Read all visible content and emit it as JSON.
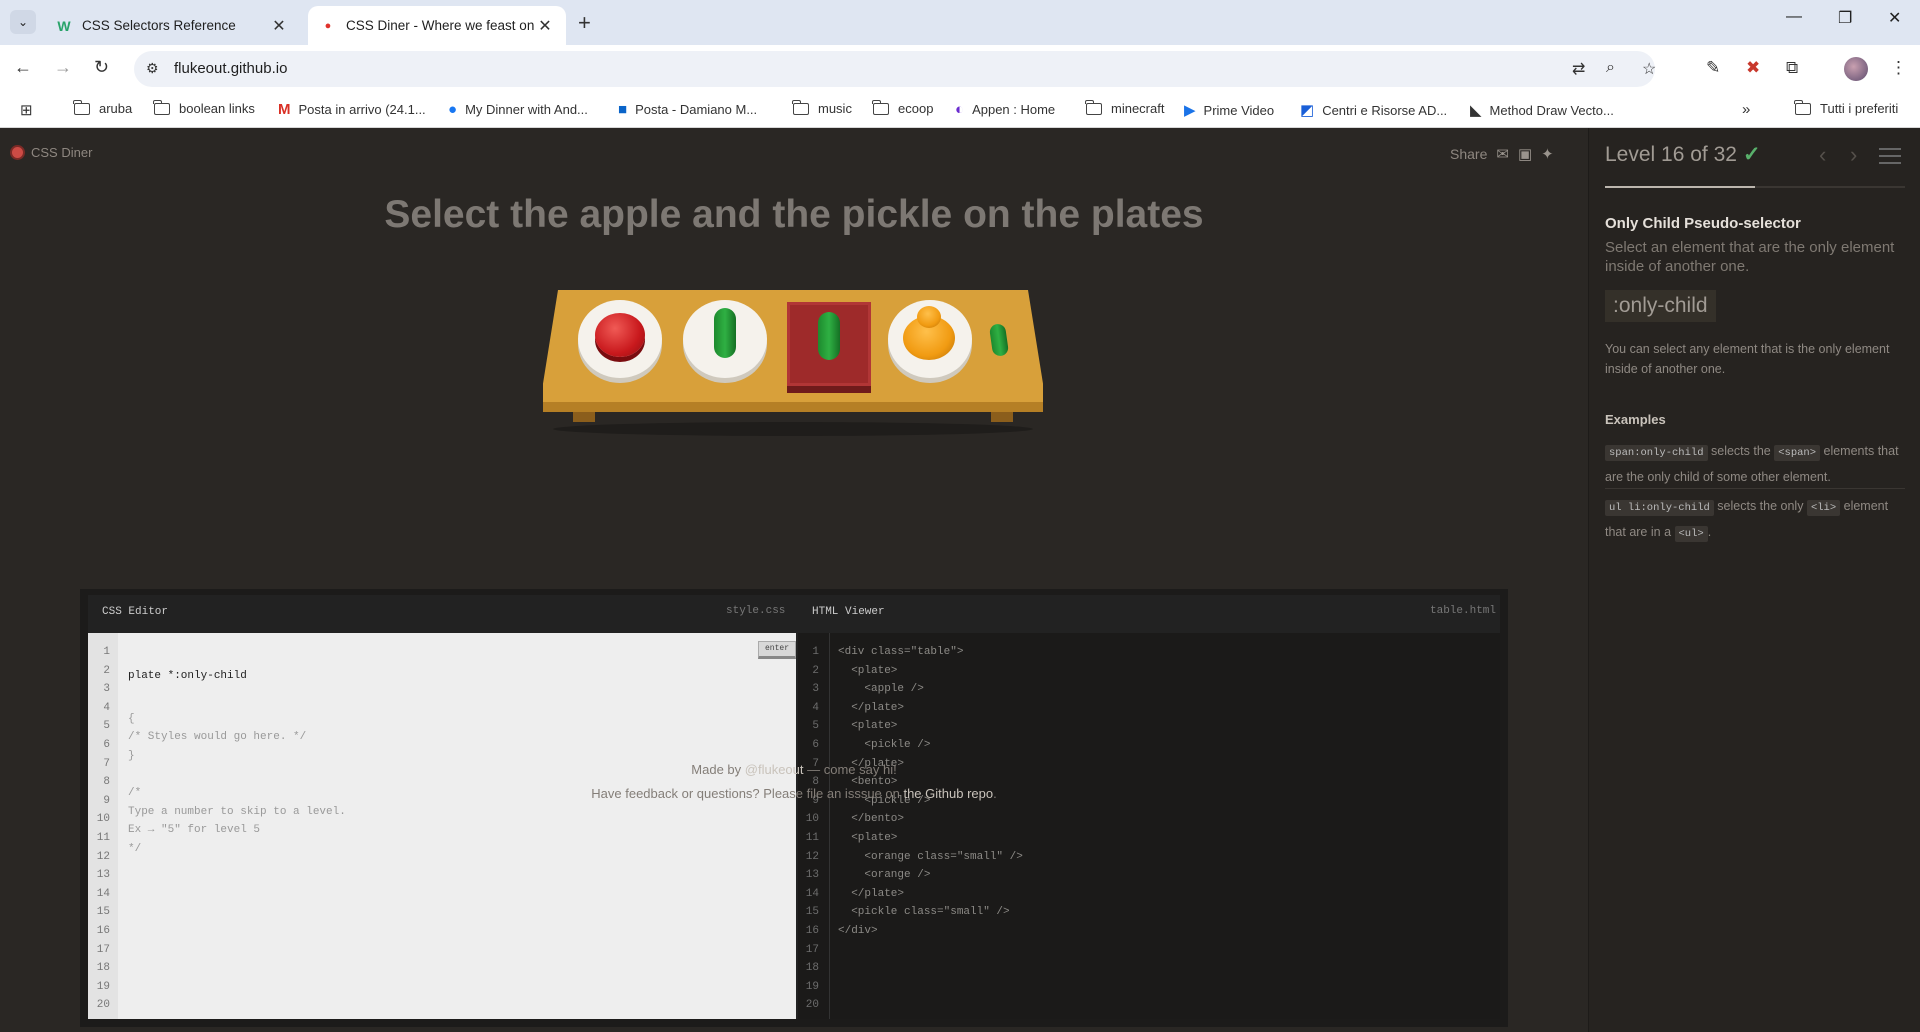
{
  "browser": {
    "tabs": [
      {
        "title": "CSS Selectors Reference",
        "favicon": "W"
      },
      {
        "title": "CSS Diner - Where we feast on",
        "favicon": "●"
      }
    ],
    "url": "flukeout.github.io",
    "bookmarks": [
      "aruba",
      "boolean links",
      "Posta in arrivo (24.1...",
      "My Dinner with And...",
      "Posta - Damiano M...",
      "music",
      "ecoop",
      "Appen : Home",
      "minecraft",
      "Prime Video",
      "Centri e Risorse AD...",
      "Method Draw Vecto..."
    ],
    "bookmarks_more": "»",
    "all_bookmarks": "Tutti i preferiti"
  },
  "app": {
    "logo": "CSS Diner",
    "share": "Share",
    "instruction": "Select the apple and the pickle on the plates"
  },
  "editor": {
    "css_title": "CSS Editor",
    "css_file": "style.css",
    "html_title": "HTML Viewer",
    "html_file": "table.html",
    "enter_label": "enter",
    "input_value": "plate *:only-child",
    "css_lines": [
      "{",
      "/* Styles would go here. */",
      "}",
      "",
      "/*",
      "Type a number to skip to a level.",
      "Ex → \"5\" for level 5",
      "*/"
    ],
    "line_numbers": [
      "1",
      "2",
      "3",
      "4",
      "5",
      "6",
      "7",
      "8",
      "9",
      "10",
      "11",
      "12",
      "13",
      "14",
      "15",
      "16",
      "17",
      "18",
      "19",
      "20"
    ],
    "html_lines": [
      "<div class=\"table\">",
      "  <plate>",
      "    <apple />",
      "  </plate>",
      "  <plate>",
      "    <pickle />",
      "  </plate>",
      "  <bento>",
      "    <pickle />",
      "  </bento>",
      "  <plate>",
      "    <orange class=\"small\" />",
      "    <orange />",
      "  </plate>",
      "  <pickle class=\"small\" />",
      "</div>"
    ]
  },
  "footer": {
    "line1_pre": "Made by ",
    "line1_link": "@flukeout",
    "line1_post": " — come say hi!",
    "line2_pre": "Have feedback or questions? Please file an isssue on ",
    "line2_link": "the Github repo",
    "line2_post": "."
  },
  "sidebar": {
    "level_text": "Level 16 of 32",
    "level_current": 16,
    "level_total": 32,
    "selector_name": "Only Child Pseudo-selector",
    "title": "Select an element that are the only element inside of another one.",
    "syntax": ":only-child",
    "hint": "You can select any element that is the only element inside of another one.",
    "examples_title": "Examples",
    "examples": [
      {
        "code": "span:only-child",
        "text1": " selects the ",
        "tag": "<span>",
        "text2": " elements that are the only child of some other element."
      },
      {
        "code": "ul li:only-child",
        "text1": " selects the only ",
        "tag": "<li>",
        "text2": " element that are in a ",
        "tag2": "<ul>",
        "text3": "."
      }
    ]
  },
  "colors": {
    "background": "#2a2724",
    "accent_check": "#59b06b",
    "table": "#d8a03a"
  }
}
